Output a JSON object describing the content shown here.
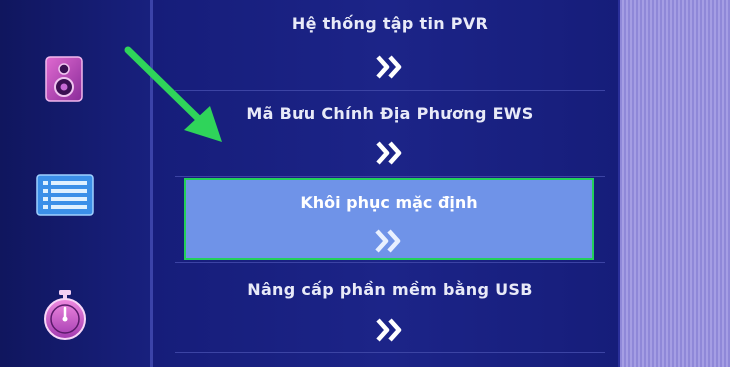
{
  "menu": {
    "items": [
      {
        "label": "Hệ thống tập tin PVR",
        "arrow_icon": "double-chevron-right-icon"
      },
      {
        "label": "Mã Bưu Chính Địa Phương EWS",
        "arrow_icon": "double-chevron-right-icon"
      },
      {
        "label": "Khôi phục mặc định",
        "arrow_icon": "double-chevron-right-icon",
        "selected": true
      },
      {
        "label": "Nâng cấp phần mềm bằng USB",
        "arrow_icon": "double-chevron-right-icon"
      }
    ]
  },
  "sidebar": {
    "icons": [
      "speaker-icon",
      "list-icon",
      "timer-icon"
    ]
  },
  "annotation": {
    "icon": "green-arrow-pointer-icon"
  },
  "colors": {
    "background": "#141a6e",
    "selected_fill": "#6f93e8",
    "selected_border": "#23d05a",
    "text": "#e8eaf8",
    "arrow_annotation": "#2fd45a"
  }
}
